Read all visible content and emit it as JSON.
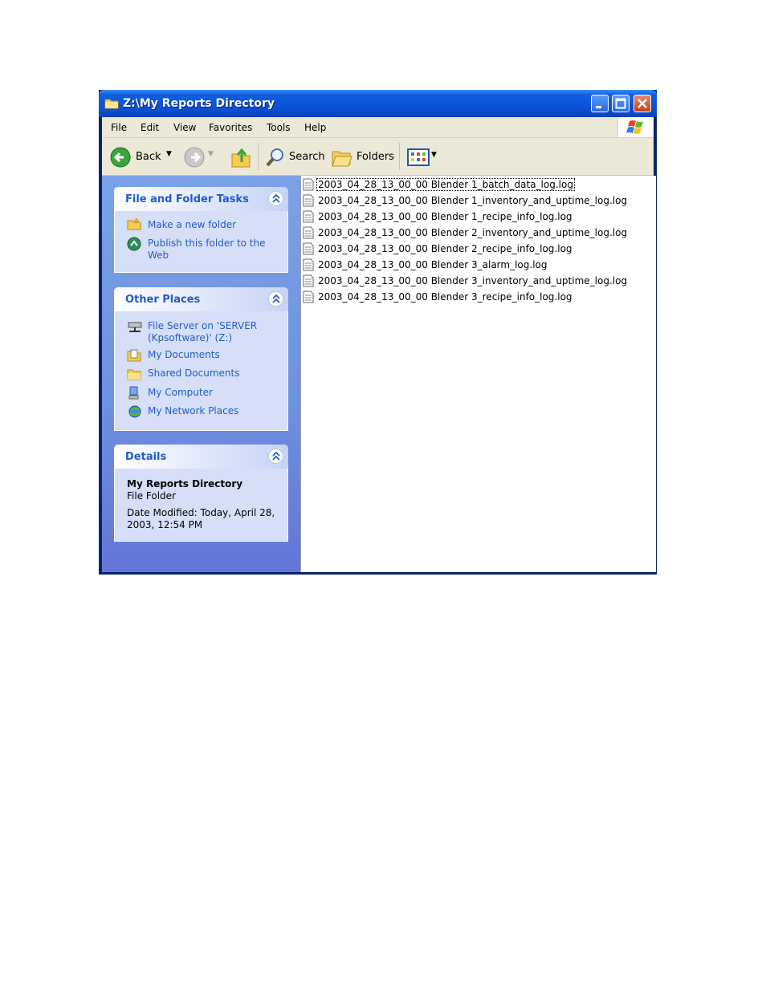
{
  "window": {
    "title": "Z:\\My Reports Directory"
  },
  "menubar": {
    "items": [
      "File",
      "Edit",
      "View",
      "Favorites",
      "Tools",
      "Help"
    ]
  },
  "toolbar": {
    "back_label": "Back",
    "search_label": "Search",
    "folders_label": "Folders"
  },
  "tasks_panel": {
    "title": "File and Folder Tasks",
    "links": [
      "Make a new folder",
      "Publish this folder to the Web"
    ]
  },
  "places_panel": {
    "title": "Other Places",
    "links": [
      "File Server on 'SERVER (Kpsoftware)' (Z:)",
      "My Documents",
      "Shared Documents",
      "My Computer",
      "My Network Places"
    ]
  },
  "details_panel": {
    "title": "Details",
    "name": "My Reports Directory",
    "type": "File Folder",
    "modified": "Date Modified: Today, April 28, 2003, 12:54 PM"
  },
  "files": [
    "2003_04_28_13_00_00 Blender 1_batch_data_log.log",
    "2003_04_28_13_00_00 Blender 1_inventory_and_uptime_log.log",
    "2003_04_28_13_00_00 Blender 1_recipe_info_log.log",
    "2003_04_28_13_00_00 Blender 2_inventory_and_uptime_log.log",
    "2003_04_28_13_00_00 Blender 2_recipe_info_log.log",
    "2003_04_28_13_00_00 Blender 3_alarm_log.log",
    "2003_04_28_13_00_00 Blender 3_inventory_and_uptime_log.log",
    "2003_04_28_13_00_00 Blender 3_recipe_info_log.log"
  ]
}
